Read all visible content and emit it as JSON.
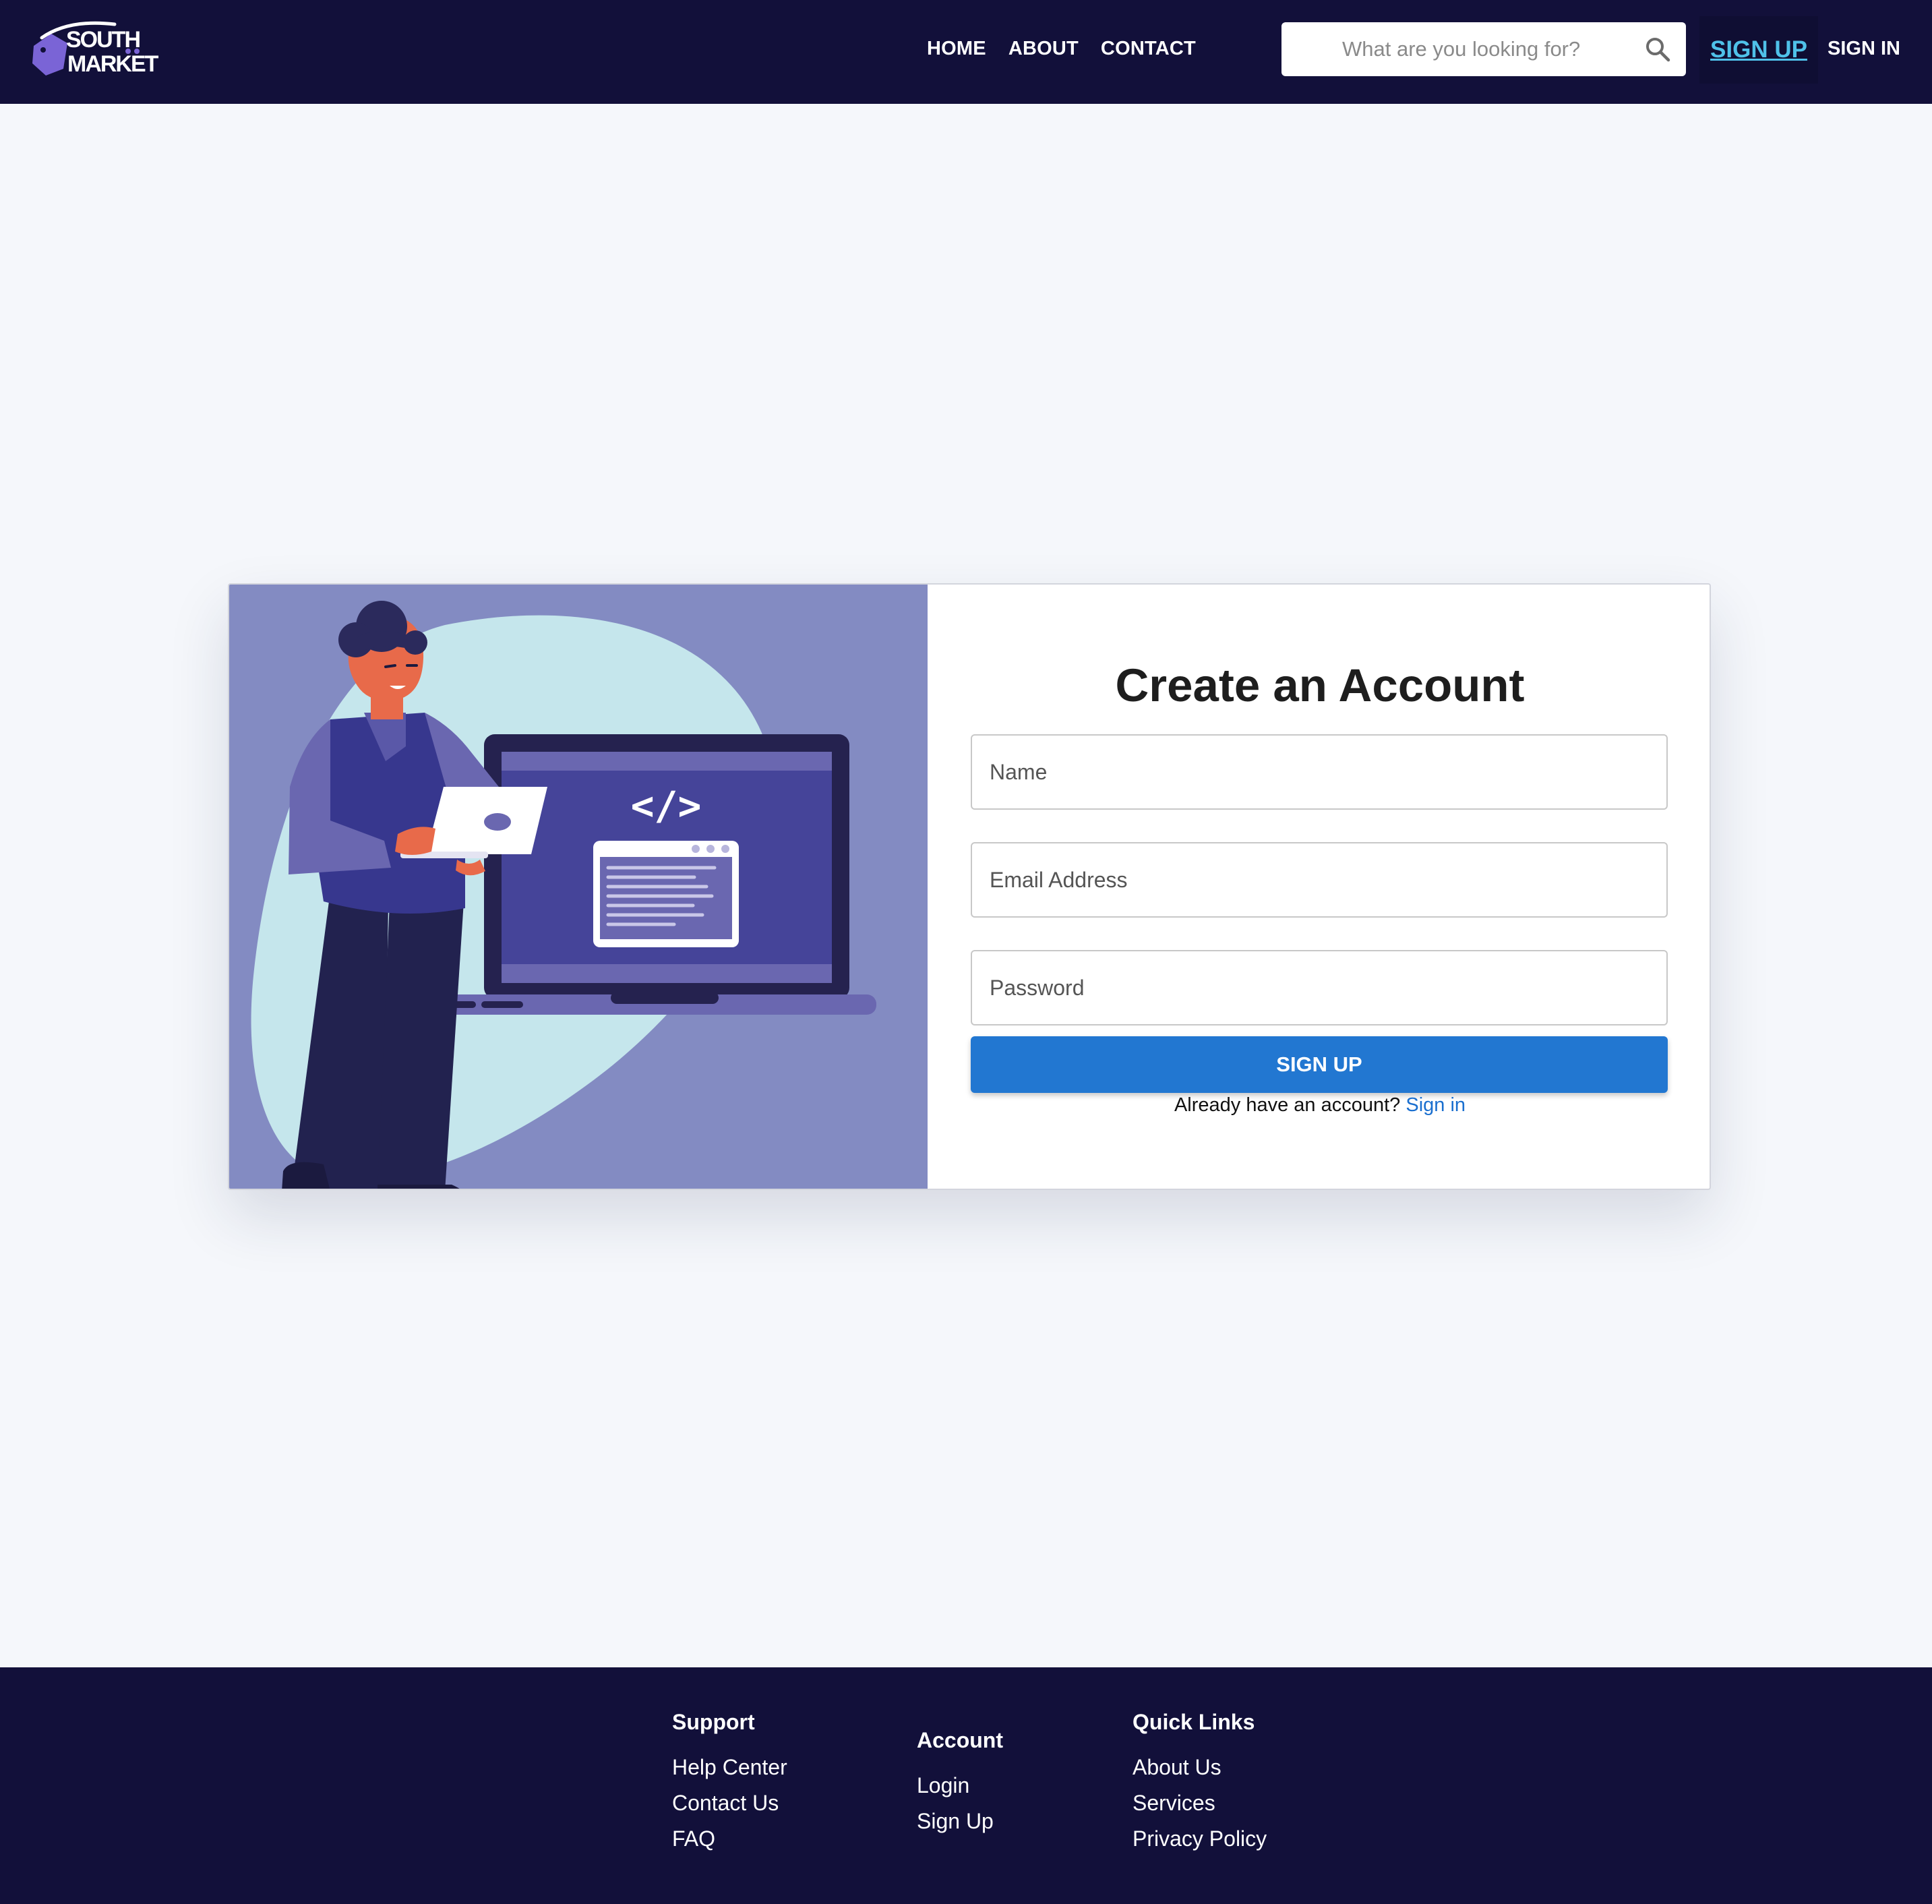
{
  "brand": {
    "logo_line1": "SOUTH",
    "logo_line2": "MARKET"
  },
  "nav": {
    "links": [
      "HOME",
      "ABOUT",
      "CONTACT"
    ],
    "search_placeholder": "What are you looking for?",
    "signup_label": "SIGN UP",
    "signin_label": "SIGN IN"
  },
  "form": {
    "title": "Create an Account",
    "name_placeholder": "Name",
    "email_placeholder": "Email Address",
    "password_placeholder": "Password",
    "submit_label": "SIGN UP",
    "hint_text": "Already have an account?",
    "hint_link": "Sign in"
  },
  "illustration": {
    "code_symbol": "</>"
  },
  "footer": {
    "support": {
      "title": "Support",
      "items": [
        "Help Center",
        "Contact Us",
        "FAQ"
      ]
    },
    "account": {
      "title": "Account",
      "items": [
        "Login",
        "Sign Up"
      ]
    },
    "quick_links": {
      "title": "Quick Links",
      "items": [
        "About Us",
        "Services",
        "Privacy Policy"
      ]
    }
  },
  "colors": {
    "navbar_bg": "#12103a",
    "accent_link": "#4fc1e9",
    "primary_button": "#2277d1",
    "illustration_bg": "#838bc2"
  }
}
